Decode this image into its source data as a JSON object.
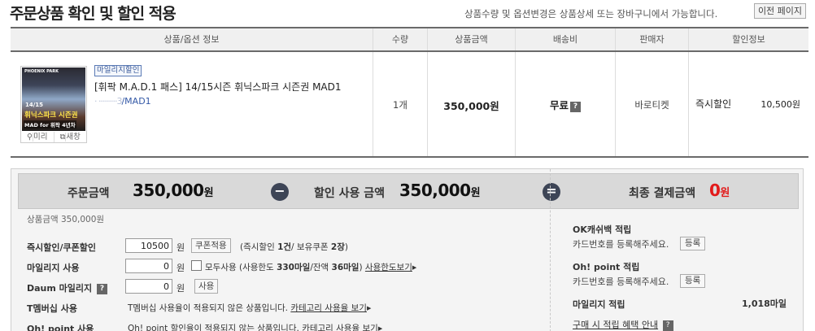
{
  "page": {
    "title": "주문상품 확인 및 할인 적용",
    "note": "상품수량 및 옵션변경은 상품상세 또는 장바구니에서 가능합니다.",
    "prev_button": "이전 페이지"
  },
  "table": {
    "headers": [
      "상품/옵션 정보",
      "수량",
      "상품금액",
      "배송비",
      "판매자",
      "할인정보"
    ],
    "row": {
      "thumb": {
        "brand": "PHOENIX PARK",
        "season": "14/15",
        "line1": "휘닉스파크 시즌권",
        "line2": "MAD for 휘팍 4년차",
        "zoom_label": "미리",
        "newwin_label": "새창"
      },
      "tag": "마일리지할인",
      "name": "[휘팍 M.A.D.1 패스] 14/15시즌 휘닉스파크 시즌권 MAD1",
      "link_blur": "· ·········3",
      "link_text": "/MAD1",
      "quantity": "1개",
      "price": "350,000원",
      "shipping": "무료",
      "shipping_help": "?",
      "seller": "바로티켓",
      "discount_type": "즉시할인",
      "discount_amount": "10,500원"
    }
  },
  "summary": {
    "order_label": "주문금액",
    "order_value": "350,000",
    "won": "원",
    "minus": "−",
    "discount_label": "할인 사용 금액",
    "discount_value": "350,000",
    "equals": "=",
    "final_label": "최종 결제금액",
    "final_value": "0",
    "sub_amount": "상품금액 350,000원"
  },
  "discounts": {
    "instant": {
      "label": "즉시할인/쿠폰할인",
      "value": "10500",
      "unit": "원",
      "button": "쿠폰적용",
      "info_prefix": "(즉시할인 ",
      "info_count": "1건",
      "info_mid": "/ 보유쿠폰 ",
      "info_coupons": "2장",
      "info_suffix": ")"
    },
    "mileage": {
      "label": "마일리지 사용",
      "value": "0",
      "unit": "원",
      "check_label": "모두사용 (사용한도 ",
      "limit": "330마일",
      "remain_label": "/잔액 ",
      "remain": "36마일",
      "close": ")",
      "link": "사용한도보기"
    },
    "daum": {
      "label": "Daum 마일리지",
      "help": "?",
      "value": "0",
      "unit": "원",
      "button": "사용"
    },
    "tmembership": {
      "label": "T멤버십 사용",
      "text": "T멤버십 사용율이 적용되지 않은 상품입니다.",
      "link": "카테고리 사용율 보기"
    },
    "ohpoint": {
      "label": "Oh! point 사용",
      "text": "Oh! point 할인율이 적용되지 않는 상품입니다.",
      "link": "카테고리 사용율 보기"
    }
  },
  "rewards": {
    "ok_title": "OK캐쉬백 적립",
    "ok_text": "카드번호를 등록해주세요.",
    "ok_button": "등록",
    "oh_title": "Oh! point 적립",
    "oh_text": "카드번호를 등록해주세요.",
    "oh_button": "등록",
    "mileage_title": "마일리지 적립",
    "mileage_value": "1,018마일",
    "benefit_link": "구매 시 적립 혜택 안내",
    "benefit_help": "?"
  },
  "colors": {
    "accent_red": "#e21a1a",
    "operator": "#3d4556",
    "link_blue": "#3358a6"
  }
}
